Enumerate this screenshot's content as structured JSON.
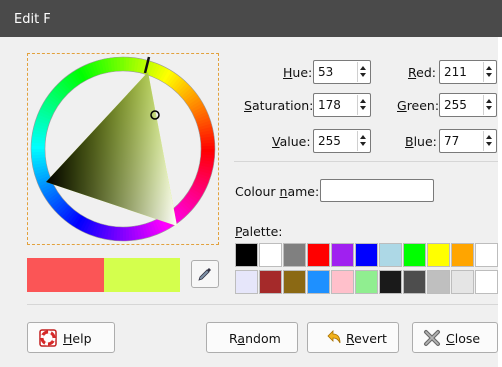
{
  "window": {
    "title": "Edit F"
  },
  "fields": {
    "hue": {
      "label": "Hue:",
      "mnemonic": "H",
      "rest": "ue:",
      "value": "53"
    },
    "saturation": {
      "label": "Saturation:",
      "mnemonic": "S",
      "rest": "aturation:",
      "value": "178"
    },
    "value": {
      "label": "Value:",
      "mnemonic": "V",
      "rest": "alue:",
      "value": "255"
    },
    "red": {
      "label": "Red:",
      "mnemonic": "R",
      "rest": "ed:",
      "value": "211"
    },
    "green": {
      "label": "Green:",
      "mnemonic": "G",
      "rest": "reen:",
      "value": "255"
    },
    "blue": {
      "label": "Blue:",
      "mnemonic": "B",
      "rest": "lue:",
      "value": "77"
    }
  },
  "colour_name": {
    "label_pre": "Colour ",
    "mnemonic": "n",
    "label_post": "ame:",
    "value": ""
  },
  "palette": {
    "label_mnemonic": "P",
    "label_rest": "alette:",
    "colors": [
      "#000000",
      "#ffffff",
      "#808080",
      "#ff0000",
      "#a020f0",
      "#0000ff",
      "#add8e6",
      "#00ff00",
      "#ffff00",
      "#ffa500",
      "#ffffff",
      "#e6e6fa",
      "#a52a2a",
      "#8b6914",
      "#1e90ff",
      "#ffc0cb",
      "#90ee90",
      "#1a1a1a",
      "#4d4d4d",
      "#bfbfbf",
      "#e5e5e5",
      "#ffffff"
    ]
  },
  "preview": {
    "old_color": "#fb5556",
    "new_color": "#d4ff4d"
  },
  "buttons": {
    "help": {
      "mnemonic": "H",
      "rest": "elp",
      "icon": "lifebuoy-icon"
    },
    "random": {
      "pre": "R",
      "mnemonic": "a",
      "rest": "ndom"
    },
    "revert": {
      "mnemonic": "R",
      "rest": "evert",
      "icon": "undo-arrow-icon"
    },
    "close": {
      "mnemonic": "C",
      "rest": "lose",
      "icon": "close-x-icon"
    }
  }
}
